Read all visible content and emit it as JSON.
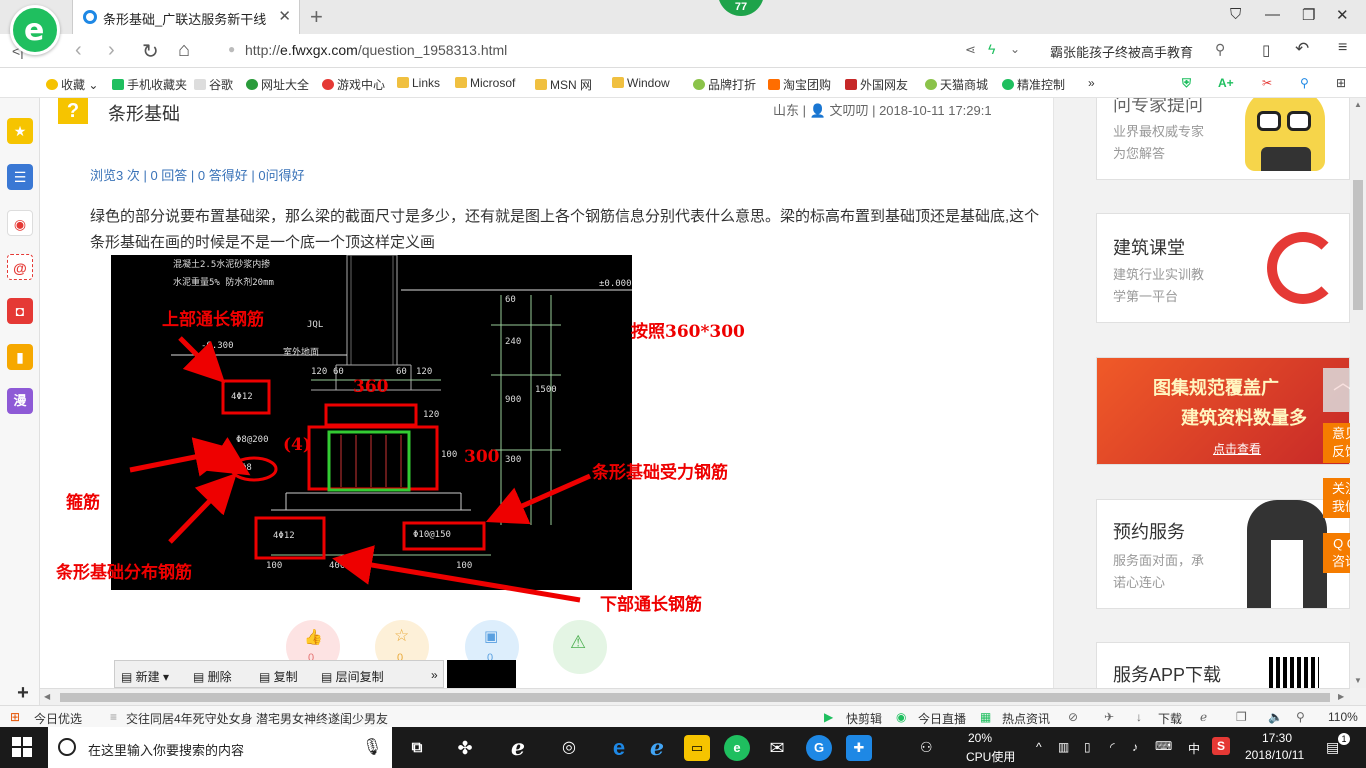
{
  "browser": {
    "tab_title": "条形基础_广联达服务新干线",
    "badge": "77",
    "url_scheme": "http://",
    "url_host": "e.fwxgx.com",
    "url_path": "/question_1958313.html",
    "search_hint": "霸张能孩子终被高手教育"
  },
  "bookmarks": [
    "收藏",
    "手机收藏夹",
    "谷歌",
    "网址大全",
    "游戏中心",
    "Links",
    "Microsof",
    "MSN 网",
    "Window",
    "品牌打折",
    "淘宝团购",
    "外国网友",
    "天猫商城",
    "精准控制"
  ],
  "sidebar": {
    "manga": "漫"
  },
  "question": {
    "title": "条形基础",
    "location": "山东",
    "author": "文叨叨",
    "datetime": "2018-10-11 17:29:1",
    "stats": {
      "views": "浏览3 次",
      "answers": "0 回答",
      "good": "0 答得好",
      "asked_good": "0问得好"
    },
    "body": "绿色的部分说要布置基础梁，那么梁的截面尺寸是多少，还有就是图上各个钢筋信息分别代表什么意思。梁的标高布置到基础顶还是基础底,这个条形基础在画的时候是不是一个底一个顶这样定义画"
  },
  "drawing": {
    "cad_texts": {
      "t1": "混凝土2.5水泥砂浆内掺",
      "t2": "水泥重量5% 防水剂20mm",
      "t3": "±0.000",
      "t4": "JQL",
      "t5": "-0.300",
      "t6": "室外地面",
      "d120a": "120",
      "d60a": "60",
      "d60b": "60",
      "d120b": "120",
      "d60v": "60",
      "d240": "240",
      "d900": "900",
      "d1500": "1500",
      "d120v": "120",
      "d100v": "100",
      "d300v": "300",
      "d100v2": "100",
      "top_bar": "4Φ12",
      "stirrup": "Φ8@200",
      "dist_bar": "Φ8",
      "bottom_bar": "4Φ12",
      "force_bar": "Φ10@150",
      "d100a": "100",
      "d400": "400",
      "d100b": "100"
    },
    "labels": {
      "top_long": "上部通长钢筋",
      "size_note": "按照360*300",
      "dim360": "360",
      "four": "(4)",
      "dim300": "300",
      "stirrup": "箍筋",
      "force": "条形基础受力钢筋",
      "distribution": "条形基础分布钢筋",
      "bottom_long": "下部通长钢筋"
    }
  },
  "actions": [
    "0",
    "0",
    "0"
  ],
  "screenshot_toolbar": [
    "新建",
    "删除",
    "复制",
    "层间复制"
  ],
  "right_cards": {
    "expert": {
      "title": "问专家提问",
      "sub1": "业界最权威专家",
      "sub2": "为您解答"
    },
    "course": {
      "title": "建筑课堂",
      "sub1": "建筑行业实训教",
      "sub2": "学第一平台"
    },
    "banner": {
      "line1": "图集规范覆盖广",
      "line2": "建筑资料数量多",
      "cta": "点击查看"
    },
    "booking": {
      "title": "预约服务",
      "sub1": "服务面对面，承",
      "sub2": "诺心连心"
    },
    "app": {
      "title": "服务APP下载"
    }
  },
  "float_buttons": {
    "feedback": [
      "意见",
      "反馈"
    ],
    "follow": [
      "关注",
      "我们"
    ],
    "qq": [
      "Q Q",
      "咨询"
    ]
  },
  "statusbar": {
    "today": "今日优选",
    "news": "交往同居4年死守处女身 潜宅男女神终遂闺少男友",
    "clip": "快剪辑",
    "live": "今日直播",
    "hot": "热点资讯",
    "download": "下载",
    "zoom": "110%"
  },
  "taskbar": {
    "search_placeholder": "在这里输入你要搜索的内容",
    "cpu_percent": "20%",
    "cpu_label": "CPU使用",
    "ime": "中",
    "time": "17:30",
    "date": "2018/10/11",
    "notifications": "1"
  }
}
